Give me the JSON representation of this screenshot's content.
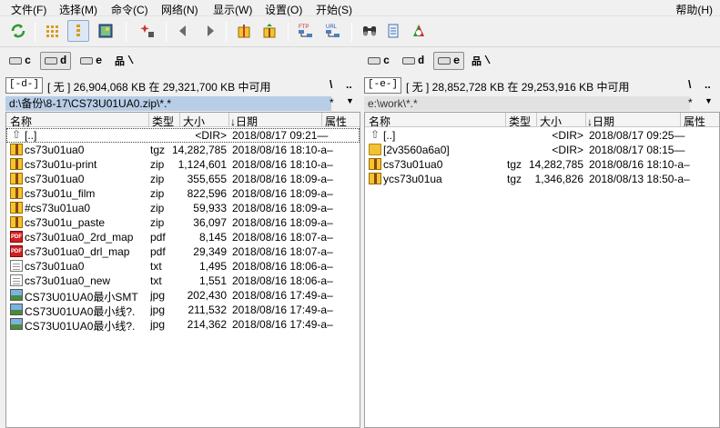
{
  "menu": [
    "文件(F)",
    "选择(M)",
    "命令(C)",
    "网络(N)",
    "显示(W)",
    "设置(O)",
    "开始(S)"
  ],
  "help": "帮助(H)",
  "toolbar_icons": [
    "refresh-icon",
    "brief-view-icon",
    "full-view-icon",
    "thumbnail-view-icon",
    "invert-selection-icon",
    "back-icon",
    "forward-icon",
    "pack-icon",
    "unpack-icon",
    "ftp-connect-icon",
    "url-connect-icon",
    "search-icon",
    "notepad-icon",
    "multi-rename-icon"
  ],
  "left": {
    "drives": [
      "c",
      "d",
      "e"
    ],
    "active_drive": "d",
    "root": "\\",
    "drive_select": "[-d-]",
    "drive_info": "[ 无 ]  26,904,068 KB 在 29,321,700 KB 中可用",
    "btn_root": "\\",
    "btn_up": "..",
    "path": "d:\\备份\\8-17\\CS73U01UA0.zip\\*.*",
    "star": "*",
    "down": "▼",
    "headers": {
      "name": "名称",
      "type": "类型",
      "size": "大小",
      "date": "↓日期",
      "attr": "属性"
    },
    "files": [
      {
        "icon": "up",
        "name": "[..]",
        "type": "",
        "size": "<DIR>",
        "date": "2018/08/17 09:21—",
        "attr": "—"
      },
      {
        "icon": "archive",
        "name": "cs73u01ua0",
        "type": "tgz",
        "size": "14,282,785",
        "date": "2018/08/16 18:10-a–",
        "attr": ""
      },
      {
        "icon": "archive",
        "name": "cs73u01u-print",
        "type": "zip",
        "size": "1,124,601",
        "date": "2018/08/16 18:10-a–",
        "attr": ""
      },
      {
        "icon": "archive",
        "name": "cs73u01ua0",
        "type": "zip",
        "size": "355,655",
        "date": "2018/08/16 18:09-a–",
        "attr": ""
      },
      {
        "icon": "archive",
        "name": "cs73u01u_film",
        "type": "zip",
        "size": "822,596",
        "date": "2018/08/16 18:09-a–",
        "attr": ""
      },
      {
        "icon": "archive",
        "name": "#cs73u01ua0",
        "type": "zip",
        "size": "59,933",
        "date": "2018/08/16 18:09-a–",
        "attr": ""
      },
      {
        "icon": "archive",
        "name": "cs73u01u_paste",
        "type": "zip",
        "size": "36,097",
        "date": "2018/08/16 18:09-a–",
        "attr": ""
      },
      {
        "icon": "pdf",
        "name": "cs73u01ua0_2rd_map",
        "type": "pdf",
        "size": "8,145",
        "date": "2018/08/16 18:07-a–",
        "attr": ""
      },
      {
        "icon": "pdf",
        "name": "cs73u01ua0_drl_map",
        "type": "pdf",
        "size": "29,349",
        "date": "2018/08/16 18:07-a–",
        "attr": ""
      },
      {
        "icon": "txt",
        "name": "cs73u01ua0",
        "type": "txt",
        "size": "1,495",
        "date": "2018/08/16 18:06-a–",
        "attr": ""
      },
      {
        "icon": "txt",
        "name": "cs73u01ua0_new",
        "type": "txt",
        "size": "1,551",
        "date": "2018/08/16 18:06-a–",
        "attr": ""
      },
      {
        "icon": "jpg",
        "name": "CS73U01UA0最小SMT",
        "type": "jpg",
        "size": "202,430",
        "date": "2018/08/16 17:49-a–",
        "attr": ""
      },
      {
        "icon": "jpg",
        "name": "CS73U01UA0最小线?.",
        "type": "jpg",
        "size": "211,532",
        "date": "2018/08/16 17:49-a–",
        "attr": ""
      },
      {
        "icon": "jpg",
        "name": "CS73U01UA0最小线?.",
        "type": "jpg",
        "size": "214,362",
        "date": "2018/08/16 17:49-a–",
        "attr": ""
      }
    ]
  },
  "right": {
    "drives": [
      "c",
      "d",
      "e"
    ],
    "active_drive": "e",
    "root": "\\",
    "drive_select": "[-e-]",
    "drive_info": "[ 无 ]  28,852,728 KB 在 29,253,916 KB 中可用",
    "btn_root": "\\",
    "btn_up": "..",
    "path": "e:\\work\\*.*",
    "star": "*",
    "down": "▼",
    "headers": {
      "name": "名称",
      "type": "类型",
      "size": "大小",
      "date": "↓日期",
      "attr": "属性"
    },
    "files": [
      {
        "icon": "up",
        "name": "[..]",
        "type": "",
        "size": "<DIR>",
        "date": "2018/08/17 09:25—",
        "attr": "—"
      },
      {
        "icon": "folder",
        "name": "[2v3560a6a0]",
        "type": "",
        "size": "<DIR>",
        "date": "2018/08/17 08:15—",
        "attr": "—"
      },
      {
        "icon": "archive",
        "name": "cs73u01ua0",
        "type": "tgz",
        "size": "14,282,785",
        "date": "2018/08/16 18:10-a–",
        "attr": ""
      },
      {
        "icon": "archive",
        "name": "ycs73u01ua",
        "type": "tgz",
        "size": "1,346,826",
        "date": "2018/08/13 18:50-a–",
        "attr": ""
      }
    ]
  }
}
